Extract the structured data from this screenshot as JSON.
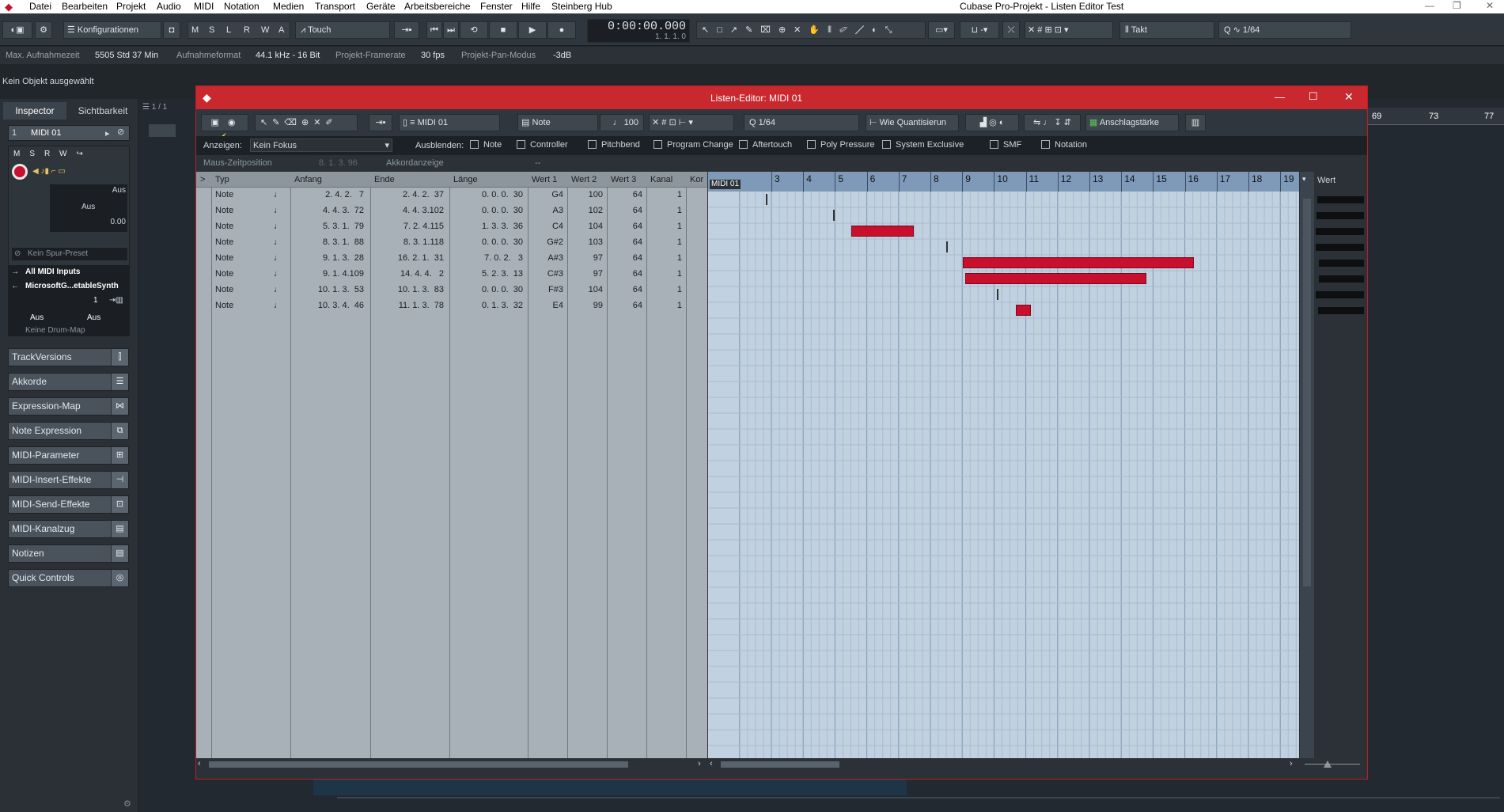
{
  "menubar": {
    "items": [
      "Datei",
      "Bearbeiten",
      "Projekt",
      "Audio",
      "MIDI",
      "Notation",
      "Medien",
      "Transport",
      "Geräte",
      "Arbeitsbereiche",
      "Fenster",
      "Hilfe",
      "Steinberg Hub"
    ],
    "window_title": "Cubase Pro-Projekt - Listen Editor Test"
  },
  "toolbar": {
    "konfigurationen": "Konfigurationen",
    "msl": [
      "M",
      "S",
      "L",
      "R",
      "W",
      "A"
    ],
    "automation_mode": "Touch",
    "time_main": "0:00:00.000",
    "time_sub": "1. 1. 1. 0",
    "grid_type": "Takt",
    "quantize": "1/64"
  },
  "infoline": {
    "max_label": "Max. Aufnahmezeit",
    "max_value": "5505 Std 37 Min",
    "format_label": "Aufnahmeformat",
    "format_value": "44.1 kHz - 16 Bit",
    "framerate_label": "Projekt-Framerate",
    "framerate_value": "30 fps",
    "pan_label": "Projekt-Pan-Modus",
    "pan_value": "-3dB"
  },
  "status": {
    "no_object": "Kein Objekt ausgewählt"
  },
  "inspector": {
    "tab_inspector": "Inspector",
    "tab_visibility": "Sichtbarkeit",
    "track_number": "1",
    "track_name": "MIDI 01",
    "fader_aus": "Aus",
    "fader_aus2": "Aus",
    "fader_value": "0.00",
    "preset": "Kein Spur-Preset",
    "input": "All MIDI Inputs",
    "output": "MicrosoftG...etableSynth",
    "channel": "1",
    "bank": "Aus",
    "program": "Aus",
    "drum_map": "Keine Drum-Map",
    "sections": [
      "TrackVersions",
      "Akkorde",
      "Expression-Map",
      "Note Expression",
      "MIDI-Parameter",
      "MIDI-Insert-Effekte",
      "MIDI-Send-Effekte",
      "MIDI-Kanalzug",
      "Notizen",
      "Quick Controls"
    ]
  },
  "project": {
    "counter": "1 / 1",
    "ruler_marks": [
      "69",
      "73",
      "77"
    ]
  },
  "editor": {
    "title": "Listen-Editor: MIDI 01",
    "track": "MIDI 01",
    "insert_type": "Note",
    "velocity": "100",
    "quantize": "1/64",
    "quantize_mode": "Wie Quantisierun",
    "velocity_lane": "Anschlagstärke",
    "filter": {
      "show_label": "Anzeigen:",
      "show_value": "Kein Fokus",
      "hide_label": "Ausblenden:",
      "options": [
        "Note",
        "Controller",
        "Pitchbend",
        "Program Change",
        "Aftertouch",
        "Poly Pressure",
        "System Exclusive",
        "SMF",
        "Notation"
      ]
    },
    "mouse_position_label": "Maus-Zeitposition",
    "mouse_position_value": "8. 1. 3. 96",
    "chord_label": "Akkordanzeige",
    "chord_value": "--",
    "columns": [
      ">",
      "Typ",
      "Anfang",
      "Ende",
      "Länge",
      "Wert 1",
      "Wert 2",
      "Wert 3",
      "Kanal",
      "Kor"
    ],
    "rows": [
      {
        "type": "Note",
        "start": "2. 4. 2.   7",
        "end": "2. 4. 2.  37",
        "length": "0. 0. 0.  30",
        "v1": "G4",
        "v2": "100",
        "v3": "64",
        "ch": "1"
      },
      {
        "type": "Note",
        "start": "4. 4. 3.  72",
        "end": "4. 4. 3.102",
        "length": "0. 0. 0.  30",
        "v1": "A3",
        "v2": "102",
        "v3": "64",
        "ch": "1"
      },
      {
        "type": "Note",
        "start": "5. 3. 1.  79",
        "end": "7. 2. 4.115",
        "length": "1. 3. 3.  36",
        "v1": "C4",
        "v2": "104",
        "v3": "64",
        "ch": "1"
      },
      {
        "type": "Note",
        "start": "8. 3. 1.  88",
        "end": "8. 3. 1.118",
        "length": "0. 0. 0.  30",
        "v1": "G#2",
        "v2": "103",
        "v3": "64",
        "ch": "1"
      },
      {
        "type": "Note",
        "start": "9. 1. 3.  28",
        "end": "16. 2. 1.  31",
        "length": "7. 0. 2.   3",
        "v1": "A#3",
        "v2": "97",
        "v3": "64",
        "ch": "1"
      },
      {
        "type": "Note",
        "start": "9. 1. 4.109",
        "end": "14. 4. 4.   2",
        "length": "5. 2. 3.  13",
        "v1": "C#3",
        "v2": "97",
        "v3": "64",
        "ch": "1"
      },
      {
        "type": "Note",
        "start": "10. 1. 3.  53",
        "end": "10. 1. 3.  83",
        "length": "0. 0. 0.  30",
        "v1": "F#3",
        "v2": "104",
        "v3": "64",
        "ch": "1"
      },
      {
        "type": "Note",
        "start": "10. 3. 4.  46",
        "end": "11. 1. 3.  78",
        "length": "0. 1. 3.  32",
        "v1": "E4",
        "v2": "99",
        "v3": "64",
        "ch": "1"
      }
    ],
    "grid_track": "MIDI 01",
    "bars": [
      "3",
      "4",
      "5",
      "6",
      "7",
      "8",
      "9",
      "10",
      "11",
      "12",
      "13",
      "14",
      "15",
      "16",
      "17",
      "18",
      "19"
    ],
    "value_header": "Wert",
    "note_events": [
      {
        "start_bar": 2.83,
        "end_bar": 2.83
      },
      {
        "start_bar": 4.93,
        "end_bar": 4.93
      },
      {
        "start_bar": 5.5,
        "end_bar": 7.47
      },
      {
        "start_bar": 8.5,
        "end_bar": 8.5
      },
      {
        "start_bar": 9.03,
        "end_bar": 16.28
      },
      {
        "start_bar": 9.1,
        "end_bar": 14.8
      },
      {
        "start_bar": 10.08,
        "end_bar": 10.08
      },
      {
        "start_bar": 10.68,
        "end_bar": 11.15
      }
    ],
    "velocities": [
      100,
      102,
      104,
      103,
      97,
      97,
      104,
      99
    ]
  },
  "colors": {
    "accent_red": "#c8282e",
    "note_red": "#c8102e",
    "grid_bg": "#c2d1e0",
    "list_bg": "#a9b1b8"
  }
}
